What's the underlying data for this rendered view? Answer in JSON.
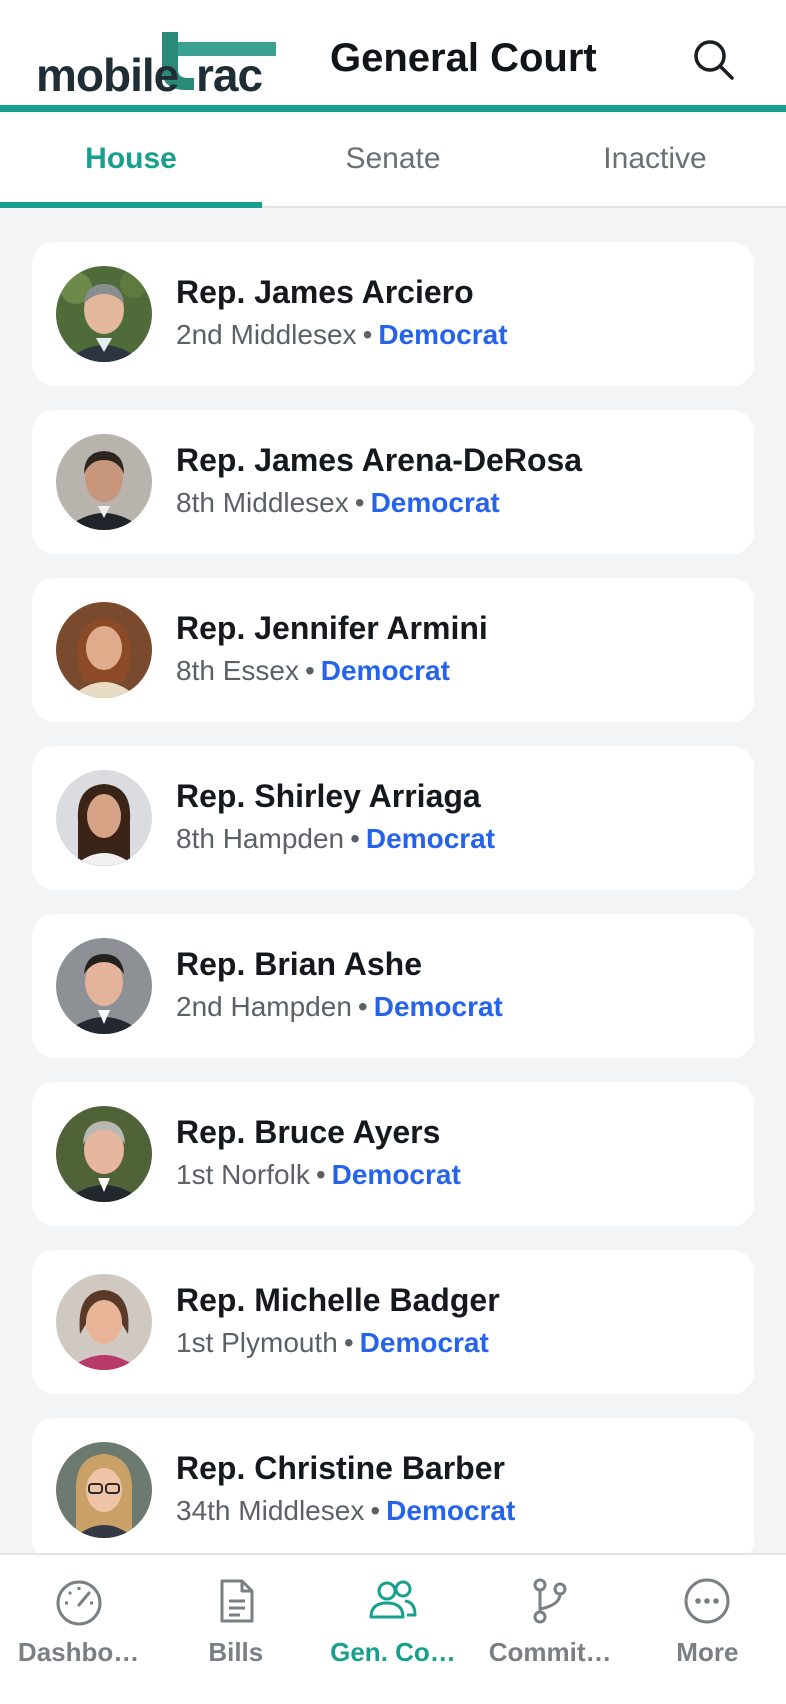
{
  "header": {
    "logo_text_a": "mobile",
    "logo_text_b": "rac",
    "title": "General Court",
    "search_icon": "search-icon"
  },
  "tabs": [
    {
      "label": "House",
      "active": true
    },
    {
      "label": "Senate",
      "active": false
    },
    {
      "label": "Inactive",
      "active": false
    }
  ],
  "members": [
    {
      "name": "Rep. James Arciero",
      "district": "2nd Middlesex",
      "separator": "•",
      "party": "Democrat"
    },
    {
      "name": "Rep. James Arena-DeRosa",
      "district": "8th Middlesex",
      "separator": "•",
      "party": "Democrat"
    },
    {
      "name": "Rep. Jennifer Armini",
      "district": "8th Essex",
      "separator": "•",
      "party": "Democrat"
    },
    {
      "name": "Rep. Shirley Arriaga",
      "district": "8th Hampden",
      "separator": "•",
      "party": "Democrat"
    },
    {
      "name": "Rep. Brian Ashe",
      "district": "2nd Hampden",
      "separator": "•",
      "party": "Democrat"
    },
    {
      "name": "Rep. Bruce Ayers",
      "district": "1st Norfolk",
      "separator": "•",
      "party": "Democrat"
    },
    {
      "name": "Rep. Michelle Badger",
      "district": "1st Plymouth",
      "separator": "•",
      "party": "Democrat"
    },
    {
      "name": "Rep. Christine Barber",
      "district": "34th Middlesex",
      "separator": "•",
      "party": "Democrat"
    }
  ],
  "bottom_nav": [
    {
      "label": "Dashbo…",
      "icon": "dashboard-gauge-icon",
      "active": false
    },
    {
      "label": "Bills",
      "icon": "document-icon",
      "active": false
    },
    {
      "label": "Gen. Co…",
      "icon": "people-icon",
      "active": true
    },
    {
      "label": "Commit…",
      "icon": "branch-icon",
      "active": false
    },
    {
      "label": "More",
      "icon": "more-dots-icon",
      "active": false
    }
  ],
  "colors": {
    "accent": "#18a08f",
    "party": "#2563eb",
    "background": "#f3f4f6"
  }
}
